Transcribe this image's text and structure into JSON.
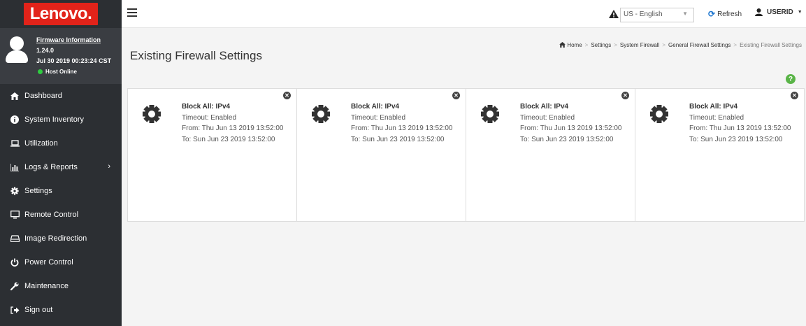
{
  "logo": "Lenovo.",
  "firmware": {
    "link": "Firmware Information",
    "version": "1.24.0",
    "date": "Jul 30 2019 00:23:24 CST",
    "status": "Host Online",
    "status_color": "#2ecc40"
  },
  "nav": [
    {
      "label": "Dashboard",
      "icon": "home-icon"
    },
    {
      "label": "System Inventory",
      "icon": "info-icon"
    },
    {
      "label": "Utilization",
      "icon": "laptop-icon"
    },
    {
      "label": "Logs & Reports",
      "icon": "bar-chart-icon"
    },
    {
      "label": "Settings",
      "icon": "gear-icon"
    },
    {
      "label": "Remote Control",
      "icon": "monitor-icon"
    },
    {
      "label": "Image Redirection",
      "icon": "drive-icon"
    },
    {
      "label": "Power Control",
      "icon": "power-icon"
    },
    {
      "label": "Maintenance",
      "icon": "wrench-icon"
    },
    {
      "label": "Sign out",
      "icon": "sign-out-icon"
    }
  ],
  "topbar": {
    "language": "US - English",
    "refresh": "Refresh",
    "user": "USERID"
  },
  "page": {
    "title": "Existing Firewall Settings"
  },
  "breadcrumb": [
    "Home",
    "Settings",
    "System Firewall",
    "General Firewall Settings",
    "Existing Firewall Settings"
  ],
  "cards": [
    {
      "title": "Block All: IPv4",
      "timeout": "Timeout: Enabled",
      "from": "From: Thu Jun 13 2019 13:52:00",
      "to": "To: Sun Jun 23 2019 13:52:00"
    },
    {
      "title": "Block All: IPv4",
      "timeout": "Timeout: Enabled",
      "from": "From: Thu Jun 13 2019 13:52:00",
      "to": "To: Sun Jun 23 2019 13:52:00"
    },
    {
      "title": "Block All: IPv4",
      "timeout": "Timeout: Enabled",
      "from": "From: Thu Jun 13 2019 13:52:00",
      "to": "To: Sun Jun 23 2019 13:52:00"
    },
    {
      "title": "Block All: IPv4",
      "timeout": "Timeout: Enabled",
      "from": "From: Thu Jun 13 2019 13:52:00",
      "to": "To: Sun Jun 23 2019 13:52:00"
    }
  ],
  "colors": {
    "sidebar": "#2c2f33",
    "brand": "#e2231a",
    "accent": "#1f77d0",
    "help": "#59b447"
  }
}
